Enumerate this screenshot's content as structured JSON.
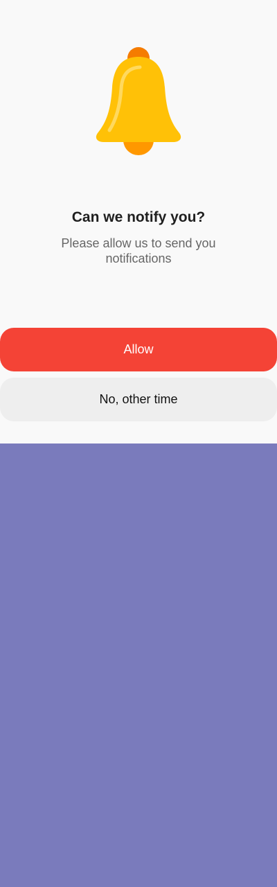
{
  "dialog": {
    "title": "Can we notify you?",
    "subtitle": "Please allow us to send you notifications",
    "allow_label": "Allow",
    "later_label": "No, other time"
  },
  "icons": {
    "hero": "bell-icon"
  },
  "colors": {
    "sheet_background": "#f9f9f9",
    "backdrop": "#7a7bbc",
    "allow_button": "#f44336",
    "later_button": "#eeeeee",
    "bell_body": "#ffc107",
    "bell_clapper": "#ff9800"
  }
}
